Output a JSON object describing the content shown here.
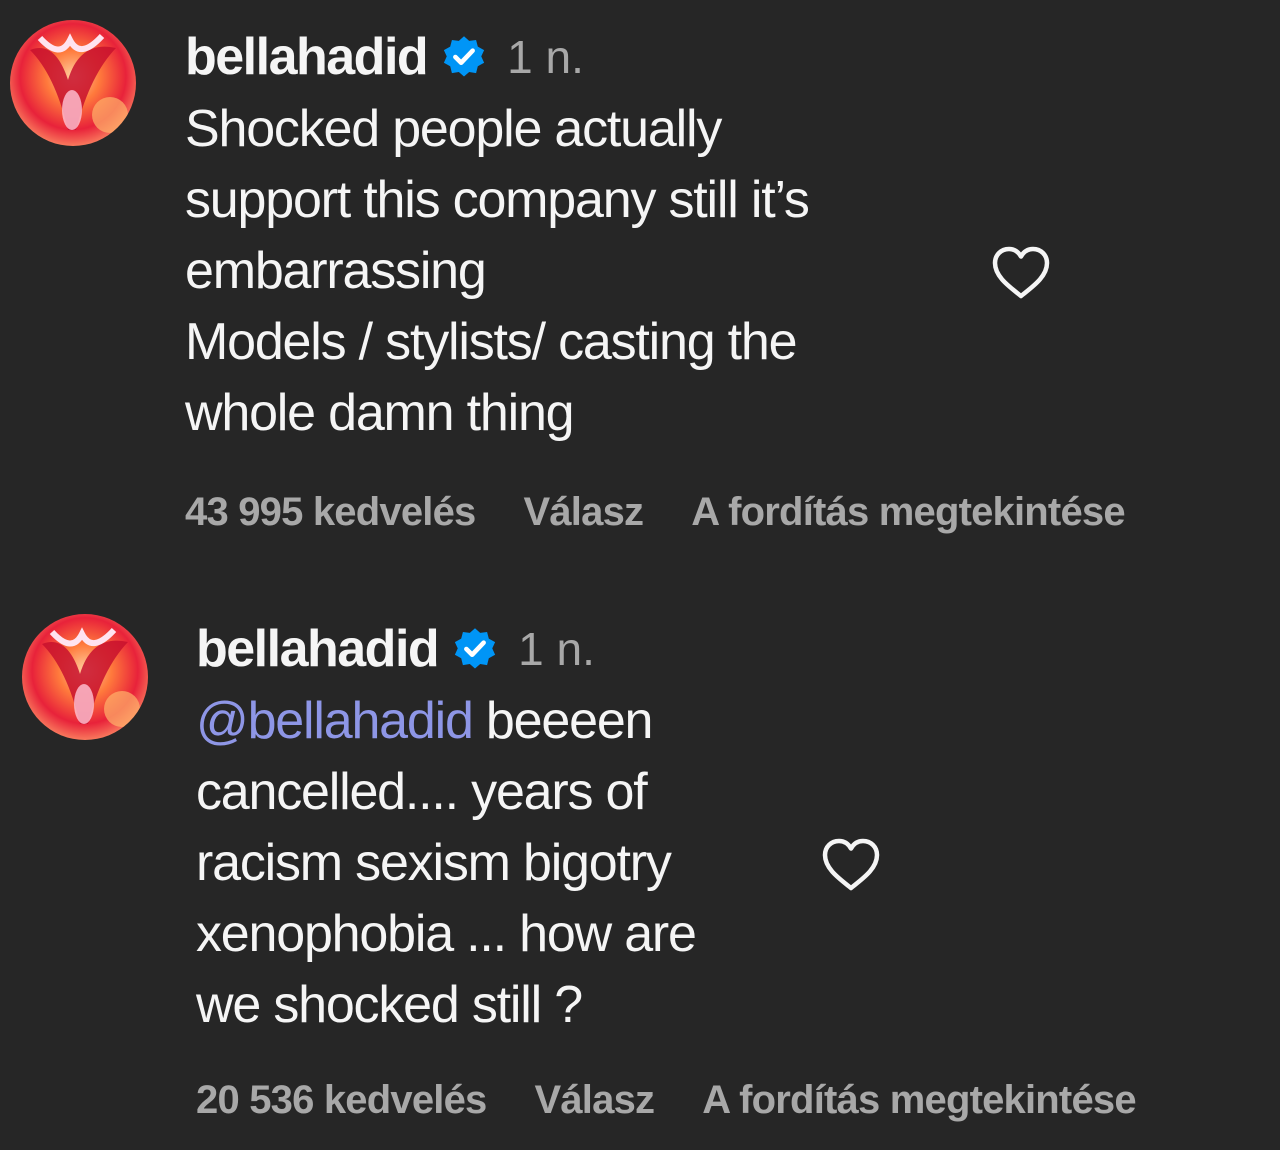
{
  "comments": [
    {
      "username": "bellahadid",
      "time": "1 n.",
      "lines": [
        "Shocked people actually",
        "support this company still it’s",
        "embarrassing",
        "Models / stylists/ casting the",
        "whole damn thing"
      ],
      "likes": "43 995 kedvelés",
      "reply": "Válasz",
      "translate": "A fordítás megtekintése"
    },
    {
      "username": "bellahadid",
      "time": "1 n.",
      "mention": "@bellahadid",
      "first_line_rest": " beeeen",
      "lines": [
        "cancelled.... years of",
        "racism sexism bigotry",
        "xenophobia ... how are",
        "we shocked still ?"
      ],
      "likes": "20 536 kedvelés",
      "reply": "Válasz",
      "translate": "A fordítás megtekintése"
    }
  ],
  "icons": {
    "verified": "verified-badge-icon",
    "like": "heart-outline-icon"
  },
  "colors": {
    "background": "#262626",
    "text": "#f5f5f5",
    "secondary": "#a8a8a8",
    "mention": "#8e96e6",
    "verified": "#0095f6"
  }
}
